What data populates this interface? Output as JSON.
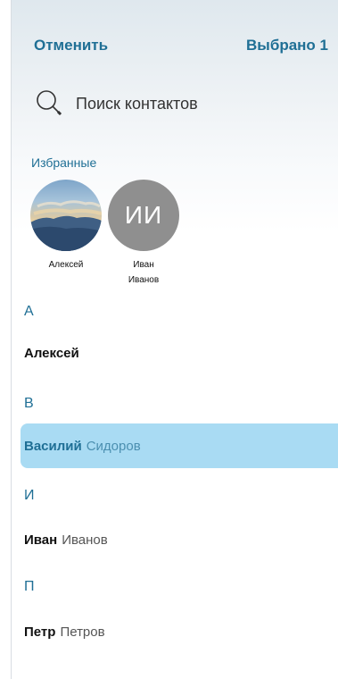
{
  "header": {
    "cancel_label": "Отменить",
    "selected_label": "Выбрано 1"
  },
  "search": {
    "placeholder": "Поиск контактов",
    "icon": "search-icon"
  },
  "favorites": {
    "title": "Избранные",
    "items": [
      {
        "name": "Алексей",
        "avatar": "photo"
      },
      {
        "name": "Иван Иванов",
        "initials": "ИИ",
        "avatar_color": "#8f8f8f"
      }
    ]
  },
  "sections": [
    {
      "letter": "А",
      "contacts": [
        {
          "first": "Алексей",
          "last": "",
          "selected": false
        }
      ]
    },
    {
      "letter": "В",
      "contacts": [
        {
          "first": "Василий",
          "last": "Сидоров",
          "selected": true
        }
      ]
    },
    {
      "letter": "И",
      "contacts": [
        {
          "first": "Иван",
          "last": "Иванов",
          "selected": false
        }
      ]
    },
    {
      "letter": "П",
      "contacts": [
        {
          "first": "Петр",
          "last": "Петров",
          "selected": false
        }
      ]
    }
  ],
  "colors": {
    "accent": "#1f6f95",
    "selected_row": "#a9dbf3",
    "avatar_gray": "#8f8f8f"
  }
}
